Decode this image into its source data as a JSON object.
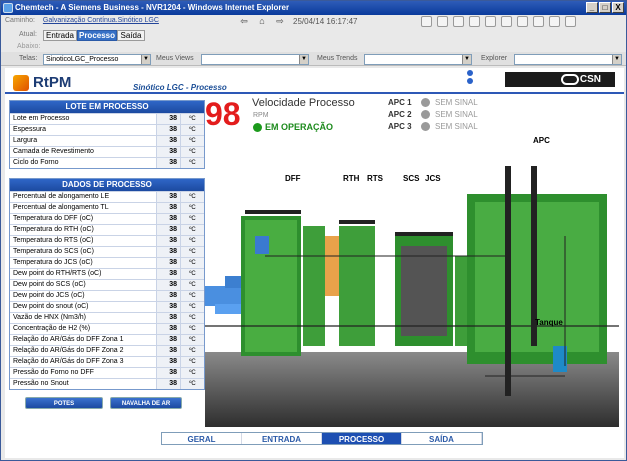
{
  "window": {
    "title": "Chemtech - A Siemens Business - NVR1204 - Windows Internet Explorer",
    "buttons": [
      "_",
      "□",
      "X"
    ]
  },
  "nav": {
    "path_label": "Caminho:",
    "path_value": "Galvanização Contínua.Sinótico LGC",
    "timestamp": "25/04/14 16:17:47",
    "current_label": "Atual:",
    "below_label": "Abaixo:",
    "tabs": [
      "Entrada",
      "Processo",
      "Saída"
    ]
  },
  "selectors": {
    "telas_label": "Telas:",
    "telas_value": "SinoticoLGC_Processo",
    "views_label": "Meus Views",
    "views_value": "",
    "trends_label": "Meus Trends",
    "trends_value": "",
    "explorer_label": "Explorer",
    "explorer_value": ""
  },
  "header": {
    "logo": "RtPM",
    "subtitle": "Sinótico LGC - Processo",
    "brand": "CSN"
  },
  "lote": {
    "title": "LOTE EM PROCESSO",
    "rows": [
      {
        "label": "Lote em Processo",
        "value": "38",
        "unit": "ºC"
      },
      {
        "label": "Espessura",
        "value": "38",
        "unit": "ºC"
      },
      {
        "label": "Largura",
        "value": "38",
        "unit": "ºC"
      },
      {
        "label": "Camada de Revestimento",
        "value": "38",
        "unit": "ºC"
      },
      {
        "label": "Ciclo do Forno",
        "value": "38",
        "unit": "ºC"
      }
    ]
  },
  "dados": {
    "title": "DADOS DE PROCESSO",
    "rows": [
      {
        "label": "Percentual de alongamento LE",
        "value": "38",
        "unit": "ºC"
      },
      {
        "label": "Percentual de alongamento TL",
        "value": "38",
        "unit": "ºC"
      },
      {
        "label": "Temperatura do DFF (oC)",
        "value": "38",
        "unit": "ºC"
      },
      {
        "label": "Temperatura do RTH (oC)",
        "value": "38",
        "unit": "ºC"
      },
      {
        "label": "Temperatura do RTS (oC)",
        "value": "38",
        "unit": "ºC"
      },
      {
        "label": "Temperatura do SCS (oC)",
        "value": "38",
        "unit": "ºC"
      },
      {
        "label": "Temperatura do JCS (oC)",
        "value": "38",
        "unit": "ºC"
      },
      {
        "label": "Dew point do RTH/RTS (oC)",
        "value": "38",
        "unit": "ºC"
      },
      {
        "label": "Dew point do SCS (oC)",
        "value": "38",
        "unit": "ºC"
      },
      {
        "label": "Dew point do JCS (oC)",
        "value": "38",
        "unit": "ºC"
      },
      {
        "label": "Dew point do snout (oC)",
        "value": "38",
        "unit": "ºC"
      },
      {
        "label": "Vazão de HNX (Nm3/h)",
        "value": "38",
        "unit": "ºC"
      },
      {
        "label": "Concentração de H2 (%)",
        "value": "38",
        "unit": "ºC"
      },
      {
        "label": "Relação do AR/Gás do DFF Zona 1",
        "value": "38",
        "unit": "ºC"
      },
      {
        "label": "Relação do AR/Gás do DFF Zona 2",
        "value": "38",
        "unit": "ºC"
      },
      {
        "label": "Relação do AR/Gás do DFF Zona 3",
        "value": "38",
        "unit": "ºC"
      },
      {
        "label": "Pressão do Forno no DFF",
        "value": "38",
        "unit": "ºC"
      },
      {
        "label": "Pressão no Snout",
        "value": "38",
        "unit": "ºC"
      }
    ]
  },
  "buttons": {
    "potes": "POTES",
    "navalha": "NAVALHA DE AR"
  },
  "speed": {
    "value": "98",
    "title": "Velocidade Processo",
    "unit": "RPM",
    "status": "EM OPERAÇÃO",
    "status_color": "#1c9a1c"
  },
  "apc": [
    {
      "name": "APC 1",
      "status": "SEM SINAL"
    },
    {
      "name": "APC 2",
      "status": "SEM SINAL"
    },
    {
      "name": "APC 3",
      "status": "SEM SINAL"
    }
  ],
  "plant": {
    "labels": {
      "dff": "DFF",
      "rth": "RTH",
      "rts": "RTS",
      "scs": "SCS",
      "jcs": "JCS",
      "apc": "APC",
      "tanque": "Tanque"
    }
  },
  "bottom_tabs": [
    "GERAL",
    "ENTRADA",
    "PROCESSO",
    "SAÍDA"
  ]
}
